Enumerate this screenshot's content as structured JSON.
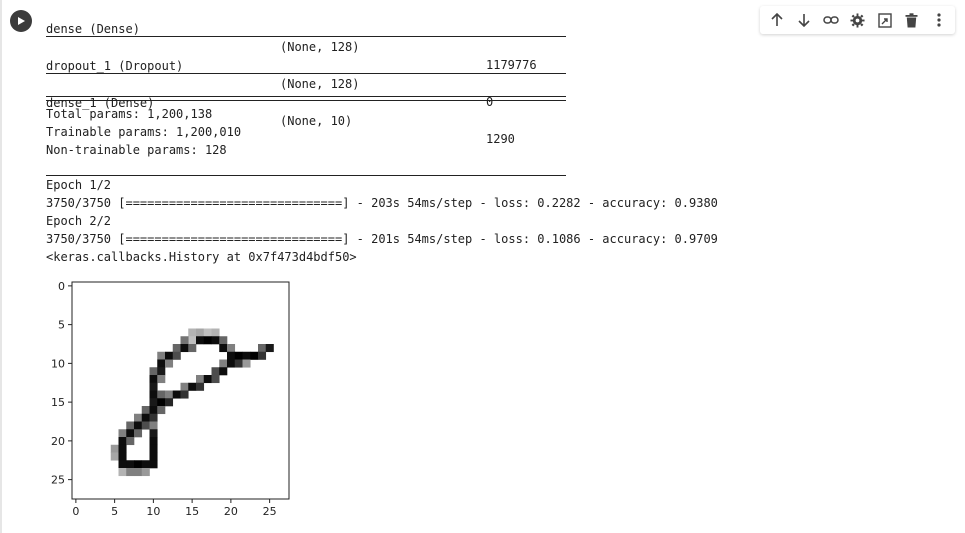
{
  "icons": {
    "run": "play-icon",
    "move_up": "arrow-up-icon",
    "move_down": "arrow-down-icon",
    "link": "link-icon",
    "settings": "gear-icon",
    "mirror": "open-in-tab-icon",
    "delete": "trash-icon",
    "more": "more-vert-icon"
  },
  "summary": {
    "layers": [
      {
        "name": "dense (Dense)",
        "shape": "(None, 128)",
        "params": "1179776"
      },
      {
        "name": "dropout_1 (Dropout)",
        "shape": "(None, 128)",
        "params": "0"
      },
      {
        "name": "dense_1 (Dense)",
        "shape": "(None, 10)",
        "params": "1290"
      }
    ],
    "double_rule": "=================================================================",
    "total_params": "Total params: 1,200,138",
    "trainable_params": "Trainable params: 1,200,010",
    "non_trainable_params": "Non-trainable params: 128"
  },
  "training": {
    "epoch1_header": "Epoch 1/2",
    "epoch1_progress": "3750/3750 [==============================] - 203s 54ms/step - loss: 0.2282 - accuracy: 0.9380",
    "epoch2_header": "Epoch 2/2",
    "epoch2_progress": "3750/3750 [==============================] - 201s 54ms/step - loss: 0.1086 - accuracy: 0.9709",
    "history_repr": "<keras.callbacks.History at 0x7f473d4bdf50>"
  },
  "figure": {
    "image_size": 28,
    "x_ticks": [
      0,
      5,
      10,
      15,
      20,
      25
    ],
    "y_ticks": [
      0,
      5,
      10,
      15,
      20,
      25
    ],
    "cmap": "binary",
    "pixels": [
      [
        6,
        15,
        0.3
      ],
      [
        7,
        15,
        0.25
      ],
      [
        6,
        16,
        0.35
      ],
      [
        6,
        17,
        0.25
      ],
      [
        6,
        18,
        0.3
      ],
      [
        7,
        14,
        0.55
      ],
      [
        7,
        16,
        0.95
      ],
      [
        7,
        17,
        1.0
      ],
      [
        7,
        18,
        0.95
      ],
      [
        7,
        19,
        0.6
      ],
      [
        8,
        13,
        0.6
      ],
      [
        8,
        14,
        0.95
      ],
      [
        8,
        15,
        0.6
      ],
      [
        8,
        19,
        0.95
      ],
      [
        8,
        20,
        0.5
      ],
      [
        8,
        24,
        0.6
      ],
      [
        8,
        25,
        0.9
      ],
      [
        9,
        11,
        0.5
      ],
      [
        9,
        12,
        0.95
      ],
      [
        9,
        13,
        0.7
      ],
      [
        9,
        20,
        0.95
      ],
      [
        9,
        21,
        1.0
      ],
      [
        9,
        22,
        0.95
      ],
      [
        9,
        23,
        1.0
      ],
      [
        9,
        24,
        0.8
      ],
      [
        10,
        11,
        0.95
      ],
      [
        10,
        12,
        0.5
      ],
      [
        10,
        19,
        0.5
      ],
      [
        10,
        20,
        0.95
      ],
      [
        10,
        21,
        0.8
      ],
      [
        10,
        22,
        0.4
      ],
      [
        11,
        10,
        0.6
      ],
      [
        11,
        11,
        0.9
      ],
      [
        11,
        18,
        0.7
      ],
      [
        11,
        19,
        0.95
      ],
      [
        12,
        10,
        0.95
      ],
      [
        12,
        11,
        0.5
      ],
      [
        12,
        16,
        0.5
      ],
      [
        12,
        17,
        0.95
      ],
      [
        12,
        18,
        0.7
      ],
      [
        13,
        10,
        0.9
      ],
      [
        13,
        14,
        0.5
      ],
      [
        13,
        15,
        0.95
      ],
      [
        13,
        16,
        0.8
      ],
      [
        14,
        10,
        0.95
      ],
      [
        14,
        11,
        0.6
      ],
      [
        14,
        12,
        0.5
      ],
      [
        14,
        13,
        0.95
      ],
      [
        14,
        14,
        0.8
      ],
      [
        15,
        10,
        0.9
      ],
      [
        15,
        11,
        1.0
      ],
      [
        15,
        12,
        0.85
      ],
      [
        16,
        9,
        0.6
      ],
      [
        16,
        10,
        0.95
      ],
      [
        16,
        11,
        0.6
      ],
      [
        17,
        8,
        0.5
      ],
      [
        17,
        9,
        0.95
      ],
      [
        17,
        10,
        0.8
      ],
      [
        18,
        7,
        0.6
      ],
      [
        18,
        8,
        0.95
      ],
      [
        18,
        9,
        0.7
      ],
      [
        18,
        10,
        0.5
      ],
      [
        19,
        6,
        0.5
      ],
      [
        19,
        7,
        0.95
      ],
      [
        19,
        8,
        0.6
      ],
      [
        19,
        10,
        0.9
      ],
      [
        20,
        6,
        0.95
      ],
      [
        20,
        7,
        0.6
      ],
      [
        20,
        10,
        0.95
      ],
      [
        21,
        5,
        0.4
      ],
      [
        21,
        6,
        0.95
      ],
      [
        21,
        10,
        0.95
      ],
      [
        22,
        5,
        0.35
      ],
      [
        22,
        6,
        0.95
      ],
      [
        22,
        10,
        0.95
      ],
      [
        23,
        6,
        0.95
      ],
      [
        23,
        7,
        0.95
      ],
      [
        23,
        8,
        1.0
      ],
      [
        23,
        9,
        0.95
      ],
      [
        23,
        10,
        0.95
      ],
      [
        24,
        6,
        0.3
      ],
      [
        24,
        7,
        0.5
      ],
      [
        24,
        8,
        0.5
      ],
      [
        24,
        9,
        0.4
      ]
    ]
  }
}
